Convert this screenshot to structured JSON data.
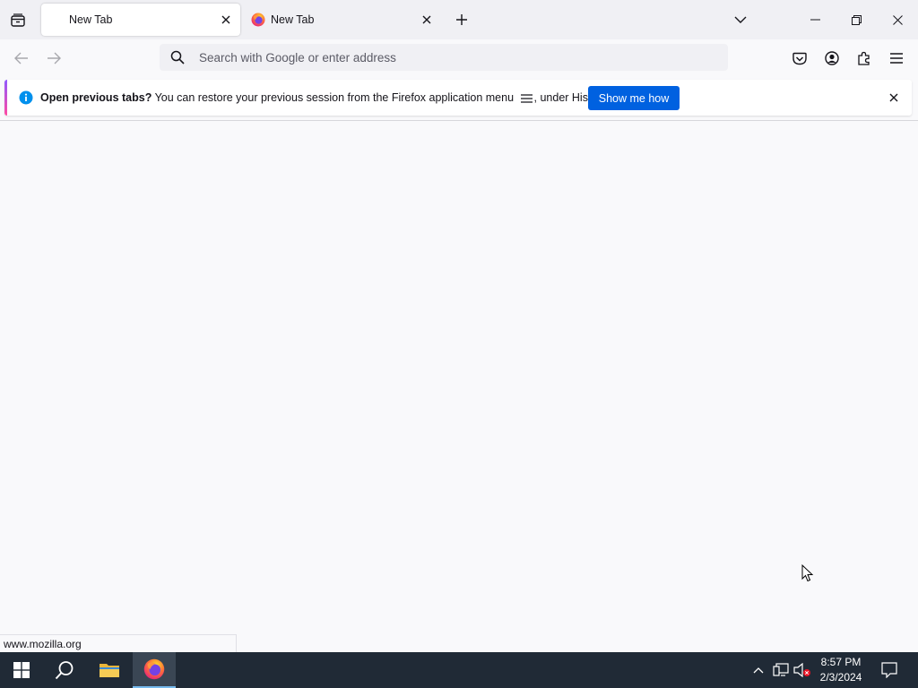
{
  "tabs": [
    {
      "label": "New Tab",
      "active": true
    },
    {
      "label": "New Tab",
      "active": false
    }
  ],
  "urlbar": {
    "placeholder": "Search with Google or enter address",
    "value": ""
  },
  "notification": {
    "bold_text": "Open previous tabs?",
    "text_before_menu": " You can restore your previous session from the Firefox application menu ",
    "text_after_menu": ", under History.",
    "button_label": "Show me how"
  },
  "status_text": "www.mozilla.org",
  "clock": {
    "time": "8:57 PM",
    "date": "2/3/2024"
  },
  "colors": {
    "accent_button": "#0061e0",
    "info_icon": "#0090ed",
    "taskbar_bg": "#202a36"
  },
  "icons": {
    "tab_list": "firefox-view-icon",
    "close": "close-icon",
    "new_tab": "plus-icon",
    "all_tabs": "chevron-down-icon",
    "back": "back-arrow-icon",
    "forward": "forward-arrow-icon",
    "search": "search-icon",
    "pocket": "pocket-icon",
    "account": "account-icon",
    "extensions": "extensions-icon",
    "menu": "hamburger-menu-icon",
    "info": "info-icon",
    "windows_start": "windows-logo-icon",
    "taskbar_search": "search-icon",
    "file_explorer": "folder-icon",
    "firefox": "firefox-icon",
    "tray_overflow": "chevron-up-icon",
    "network": "network-icon",
    "volume": "volume-muted-icon",
    "notifications": "action-center-icon"
  }
}
